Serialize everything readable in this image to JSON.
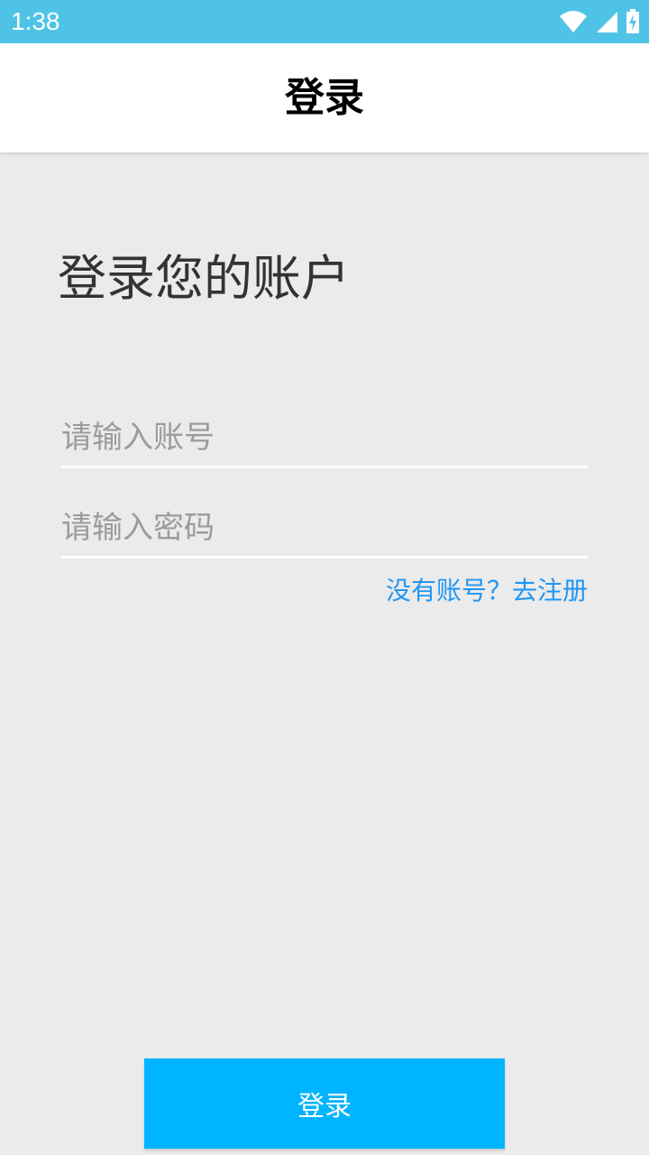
{
  "status_bar": {
    "time": "1:38",
    "icons": [
      "wifi-icon",
      "cellular-signal-icon",
      "battery-charging-icon"
    ],
    "background": "#4fc3e6"
  },
  "app_bar": {
    "title": "登录"
  },
  "main": {
    "heading": "登录您的账户",
    "account_placeholder": "请输入账号",
    "password_placeholder": "请输入密码",
    "register_link": "没有账号？去注册",
    "login_button": "登录"
  },
  "colors": {
    "accent": "#00b4ff",
    "link": "#2196f3",
    "background": "#ebebeb"
  }
}
